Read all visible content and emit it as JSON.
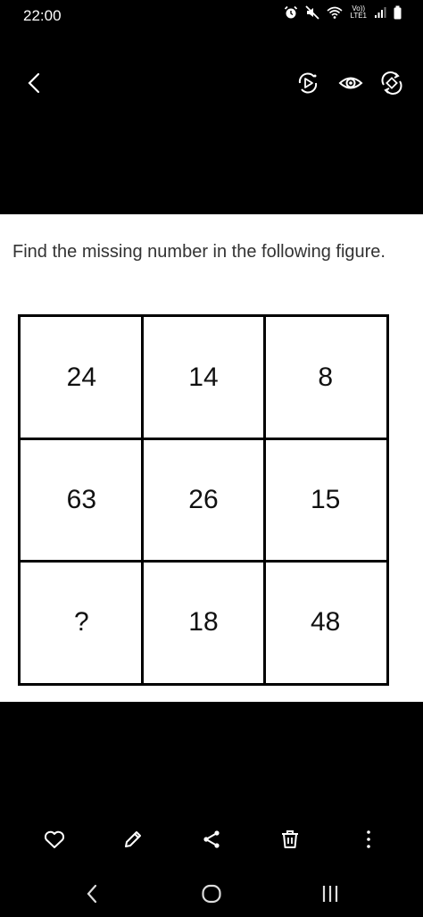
{
  "status_bar": {
    "time": "22:00",
    "icons": [
      "alarm-icon",
      "mute-icon",
      "wifi-icon",
      "volte-lte-icon",
      "signal-icon",
      "battery-icon"
    ],
    "volte_top": "Vo))",
    "volte_bottom": "LTE1"
  },
  "toolbar": {
    "icons": [
      "back-chevron-icon",
      "remaster-icon",
      "eye-icon",
      "rotate-icon"
    ]
  },
  "question": {
    "text": "Find the missing number in the following figure."
  },
  "puzzle": {
    "rows": [
      [
        "24",
        "14",
        "8"
      ],
      [
        "63",
        "26",
        "15"
      ],
      [
        "?",
        "18",
        "48"
      ]
    ]
  },
  "actions": {
    "icons": [
      "heart-icon",
      "edit-pencil-icon",
      "share-icon",
      "trash-icon",
      "more-vertical-icon"
    ]
  },
  "navigation": {
    "icons": [
      "nav-back-icon",
      "nav-home-icon",
      "nav-recents-icon"
    ]
  },
  "colors": {
    "background": "#000000",
    "content_background": "#ffffff",
    "question_text": "#333333"
  }
}
